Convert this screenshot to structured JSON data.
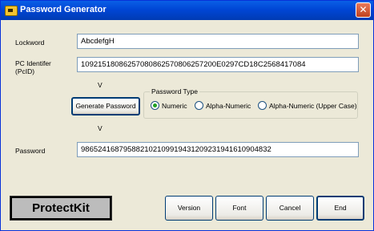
{
  "window": {
    "title": "Password Generator",
    "title_icon": "key-icon",
    "close_icon": "close-icon",
    "close_glyph": "✕"
  },
  "lockword": {
    "label": "Lockword",
    "value": "AbcdefgH"
  },
  "pc_identifier": {
    "label_line1": "PC Identifer",
    "label_line2": "(PcID)",
    "value": "10921518086257080862570806257200E0297CD18C2568417084"
  },
  "arrows": {
    "first": "V",
    "second": "V"
  },
  "generate_button": {
    "label": "Generate Password"
  },
  "password_type": {
    "group_label": "Password Type",
    "options": [
      {
        "label": "Numeric",
        "checked": true
      },
      {
        "label": "Alpha-Numeric",
        "checked": false
      },
      {
        "label": "Alpha-Numeric (Upper Case)",
        "checked": false
      }
    ]
  },
  "password": {
    "label": "Password",
    "value": "98652416879588210210991943120923194161090483​2"
  },
  "footer": {
    "brand": "ProtectKit",
    "version": "Version",
    "font": "Font",
    "cancel": "Cancel",
    "end": "End"
  },
  "colors": {
    "title_bar": "#0046d5",
    "close_button": "#c2421e",
    "dialog_bg": "#ece9d8",
    "radio_selected": "#21a121"
  }
}
